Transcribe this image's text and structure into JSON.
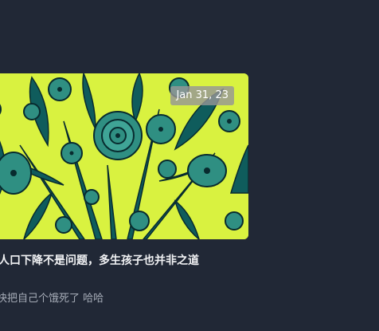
{
  "post": {
    "date": "Jan 31, 23",
    "title": "英」人口下降不是问题，多生孩子也并非之道",
    "summary": "时报快把自己个饿死了 哈哈"
  },
  "colors": {
    "background": "#212836",
    "image_base": "#d9f240",
    "image_ink": "#0f5c5c"
  },
  "icons": {
    "image": "flower-illustration"
  }
}
